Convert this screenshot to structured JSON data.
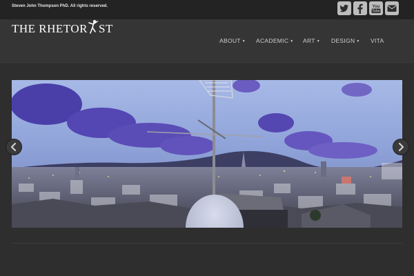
{
  "topbar": {
    "copyright": "Steven John Thompson PhD. All rights reserved."
  },
  "social": {
    "icons": [
      "twitter-icon",
      "facebook-icon",
      "youtube-icon",
      "email-icon"
    ]
  },
  "brand": {
    "logo_text": "THE RHETORIST",
    "logo_accent_letter": "I"
  },
  "nav": {
    "items": [
      "ABOUT",
      "ACADEMIC",
      "ART",
      "DESIGN",
      "VITA"
    ]
  },
  "slider": {
    "prev_icon": "chevron-left-icon",
    "next_icon": "chevron-right-icon"
  },
  "colors": {
    "background": "#2e2e2e",
    "header": "#353535",
    "topbar": "#232323",
    "nav_text": "#cfcfcf"
  }
}
